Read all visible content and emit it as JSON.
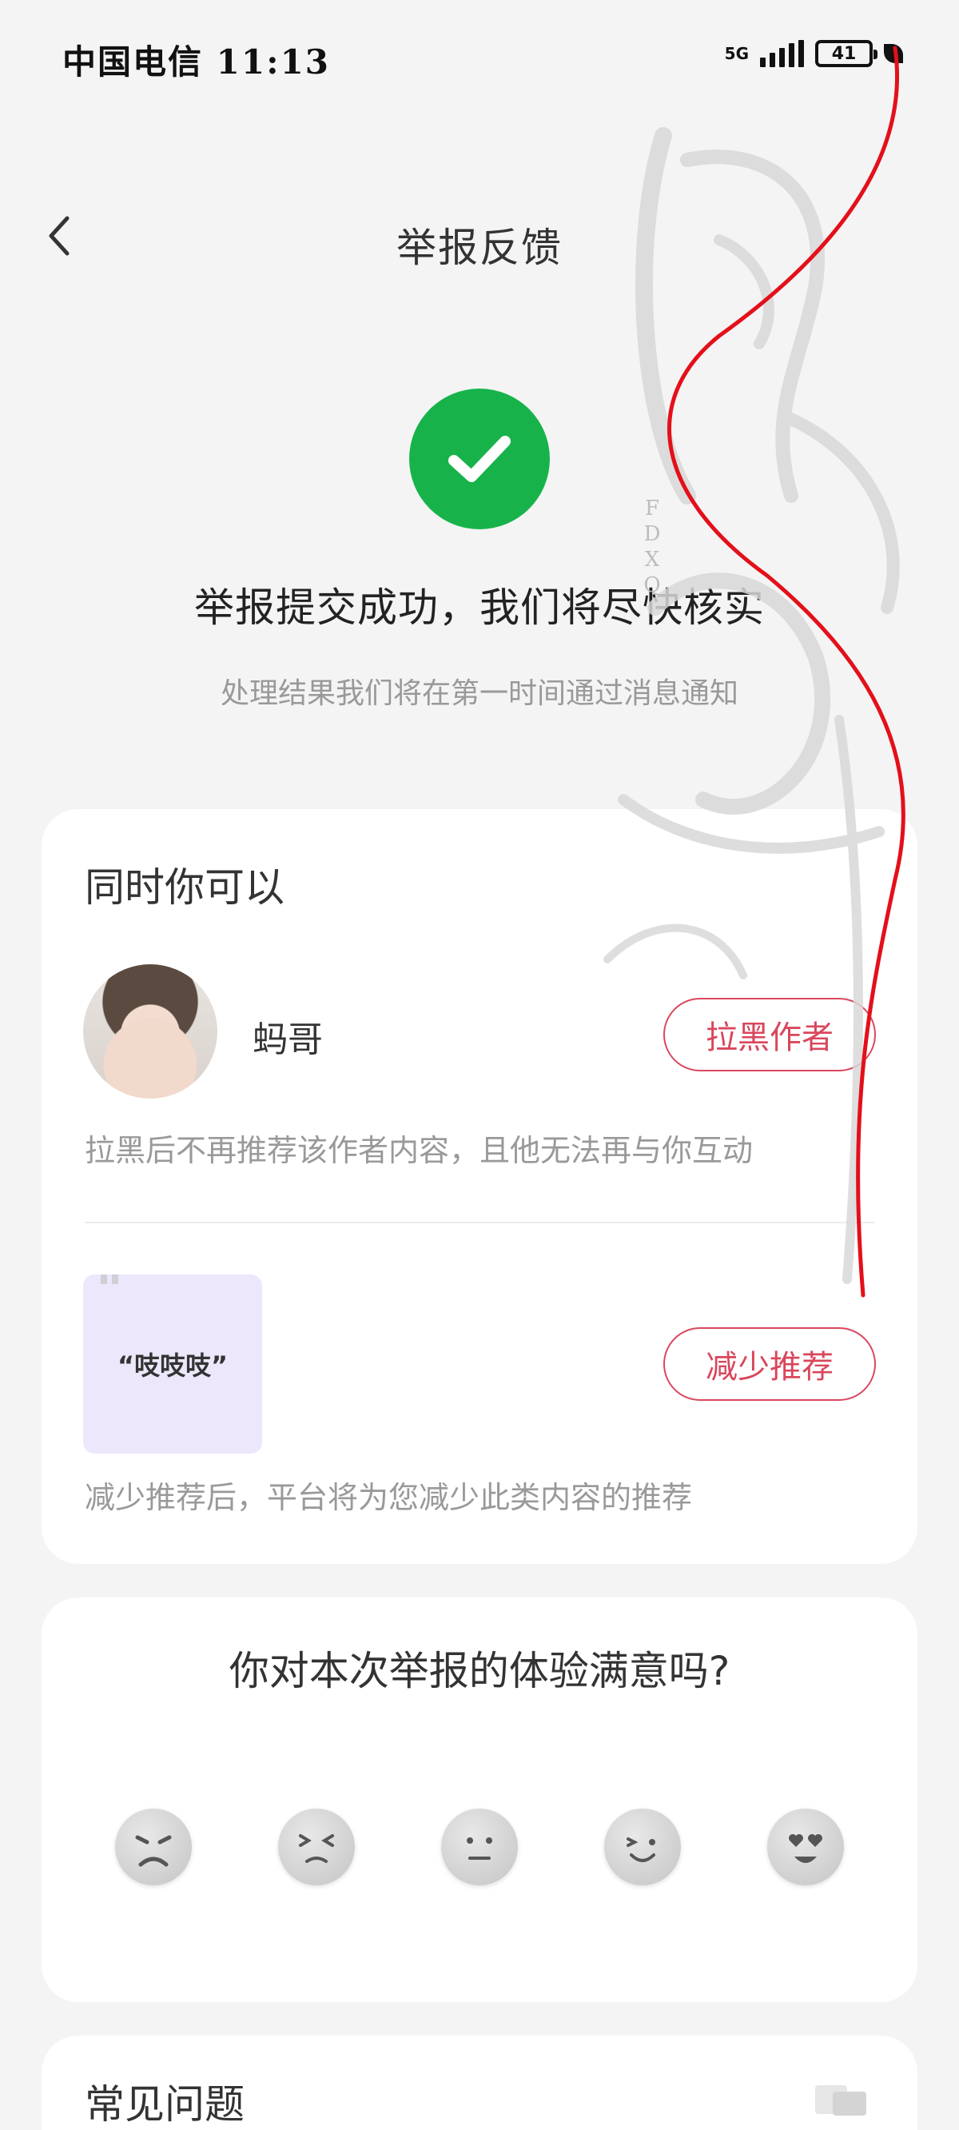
{
  "status_bar": {
    "carrier_time": "中国电信 11:13",
    "network": "5G",
    "battery": "41"
  },
  "header": {
    "title": "举报反馈"
  },
  "result": {
    "title": "举报提交成功，我们将尽快核实",
    "subtitle": "处理结果我们将在第一时间通过消息通知"
  },
  "actions": {
    "section_title": "同时你可以",
    "author": {
      "name": "蚂哥",
      "button": "拉黑作者",
      "description": "拉黑后不再推荐该作者内容，且他无法再与你互动"
    },
    "content": {
      "thumb_text": "“吱吱吱”",
      "button": "减少推荐",
      "description": "减少推荐后，平台将为您减少此类内容的推荐"
    }
  },
  "rating": {
    "title": "你对本次举报的体验满意吗?",
    "options": [
      "very-unsatisfied-face-icon",
      "unsatisfied-face-icon",
      "neutral-face-icon",
      "satisfied-face-icon",
      "very-satisfied-face-icon"
    ]
  },
  "faq": {
    "title": "常见问题"
  },
  "watermark": {
    "letters": "FDXQ"
  },
  "colors": {
    "accent": "#d9475c",
    "success": "#17b34a",
    "background": "#f4f4f4"
  }
}
